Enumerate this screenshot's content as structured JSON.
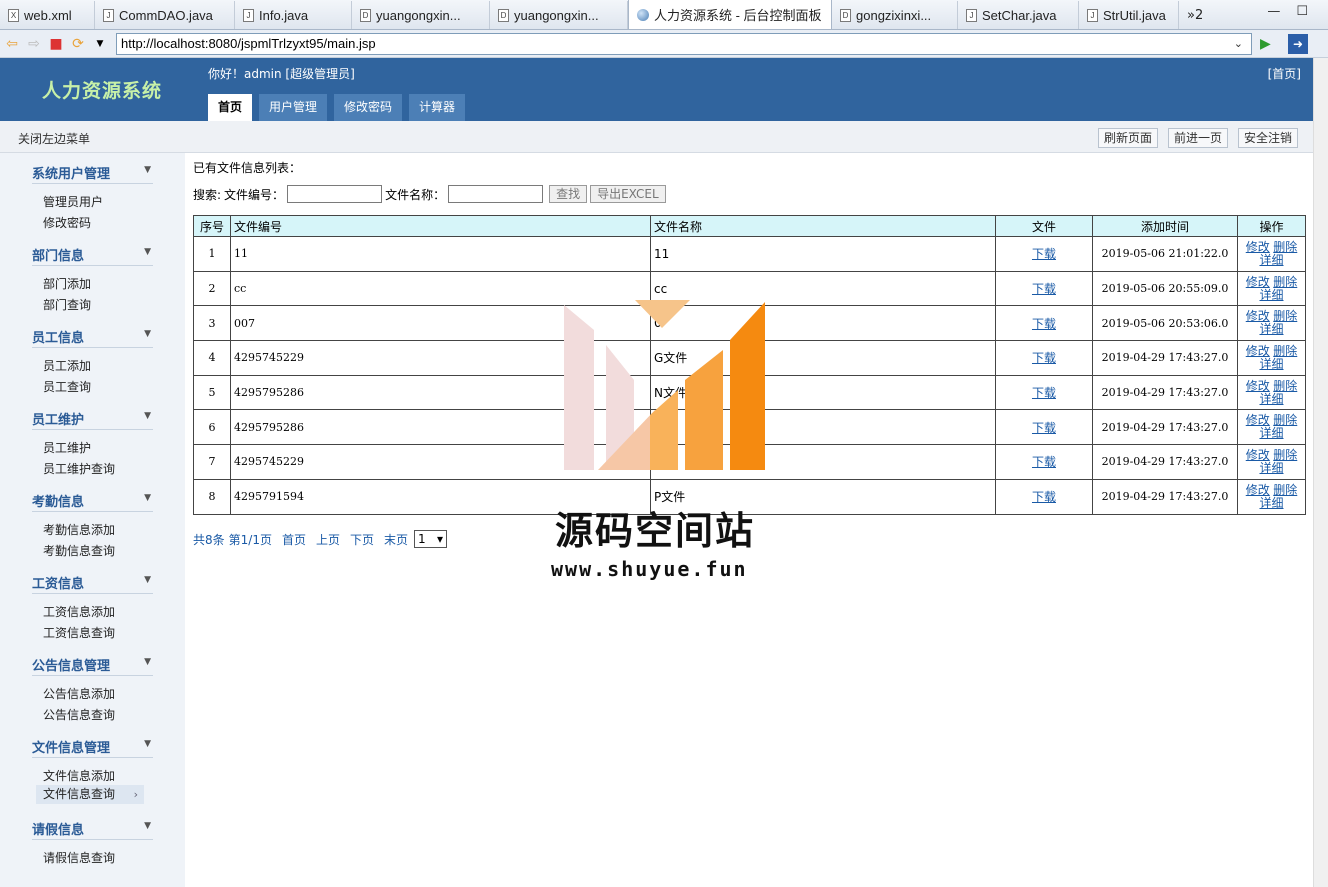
{
  "ide": {
    "tabs": [
      {
        "label": "web.xml",
        "icon": "X"
      },
      {
        "label": "CommDAO.java",
        "icon": "J"
      },
      {
        "label": "Info.java",
        "icon": "J"
      },
      {
        "label": "yuangongxin...",
        "icon": "D"
      },
      {
        "label": "yuangongxin...",
        "icon": "D"
      },
      {
        "label": "人力资源系统 - 后台控制面板",
        "icon": "globe",
        "active": true
      },
      {
        "label": "gongzixinxi...",
        "icon": "D"
      },
      {
        "label": "SetChar.java",
        "icon": "J"
      },
      {
        "label": "StrUtil.java",
        "icon": "J"
      }
    ],
    "overflow": "»2"
  },
  "browser": {
    "url": "http://localhost:8080/jspmlTrlzyxt95/main.jsp"
  },
  "header": {
    "logo": "人力资源系统",
    "greeting": "你好！admin [超级管理员]",
    "home": "[首页]",
    "nav": [
      "首页",
      "用户管理",
      "修改密码",
      "计算器"
    ]
  },
  "toolbar": {
    "close_menu": "关闭左边菜单",
    "refresh": "刷新页面",
    "forward": "前进一页",
    "logout": "安全注销"
  },
  "sidebar": {
    "groups": [
      {
        "title": "系统用户管理",
        "items": [
          "管理员用户",
          "修改密码"
        ]
      },
      {
        "title": "部门信息",
        "items": [
          "部门添加",
          "部门查询"
        ]
      },
      {
        "title": "员工信息",
        "items": [
          "员工添加",
          "员工查询"
        ]
      },
      {
        "title": "员工维护",
        "items": [
          "员工维护",
          "员工维护查询"
        ]
      },
      {
        "title": "考勤信息",
        "items": [
          "考勤信息添加",
          "考勤信息查询"
        ]
      },
      {
        "title": "工资信息",
        "items": [
          "工资信息添加",
          "工资信息查询"
        ]
      },
      {
        "title": "公告信息管理",
        "items": [
          "公告信息添加",
          "公告信息查询"
        ]
      },
      {
        "title": "文件信息管理",
        "items": [
          "文件信息添加",
          "文件信息查询"
        ]
      },
      {
        "title": "请假信息",
        "items": [
          "请假信息查询"
        ]
      }
    ]
  },
  "content": {
    "list_title": "已有文件信息列表：",
    "search": {
      "label": "搜索:",
      "field1": "文件编号：",
      "field2": "文件名称：",
      "find": "查找",
      "export": "导出EXCEL"
    },
    "columns": [
      "序号",
      "文件编号",
      "文件名称",
      "文件",
      "添加时间",
      "操作"
    ],
    "rows": [
      {
        "no": "1",
        "code": "11",
        "name": "11",
        "time": "2019-05-06 21:01:22.0"
      },
      {
        "no": "2",
        "code": "cc",
        "name": "cc",
        "time": "2019-05-06 20:55:09.0"
      },
      {
        "no": "3",
        "code": "007",
        "name": "0",
        "time": "2019-05-06 20:53:06.0"
      },
      {
        "no": "4",
        "code": "4295745229",
        "name": "G文件",
        "time": "2019-04-29 17:43:27.0"
      },
      {
        "no": "5",
        "code": "4295795286",
        "name": "N文件",
        "time": "2019-04-29 17:43:27.0"
      },
      {
        "no": "6",
        "code": "4295795286",
        "name": "件",
        "time": "2019-04-29 17:43:27.0"
      },
      {
        "no": "7",
        "code": "4295745229",
        "name": "件",
        "time": "2019-04-29 17:43:27.0"
      },
      {
        "no": "8",
        "code": "4295791594",
        "name": "P文件",
        "time": "2019-04-29 17:43:27.0"
      }
    ],
    "download": "下载",
    "op_edit": "修改",
    "op_delete": "删除",
    "op_detail": "详细",
    "pager": {
      "total": "共8条",
      "page": "第1/1页",
      "first": "首页",
      "prev": "上页",
      "next": "下页",
      "last": "末页",
      "select": "1"
    }
  },
  "watermark": {
    "title": "源码空间站",
    "url": "www.shuyue.fun"
  }
}
